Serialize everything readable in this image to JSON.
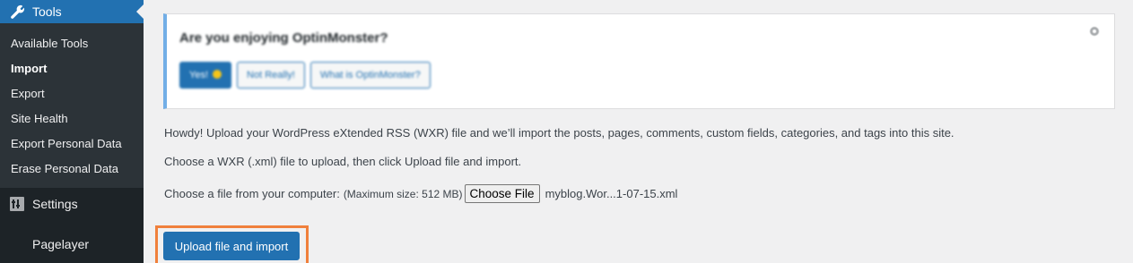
{
  "sidebar": {
    "tools_label": "Tools",
    "submenu": [
      {
        "label": "Available Tools"
      },
      {
        "label": "Import"
      },
      {
        "label": "Export"
      },
      {
        "label": "Site Health"
      },
      {
        "label": "Export Personal Data"
      },
      {
        "label": "Erase Personal Data"
      }
    ],
    "settings_label": "Settings",
    "pagelayer_label": "Pagelayer"
  },
  "notice": {
    "title": "Are you enjoying OptinMonster?",
    "yes_label": "Yes!",
    "not_really_label": "Not Really!",
    "what_is_label": "What is OptinMonster?"
  },
  "main": {
    "intro": "Howdy! Upload your WordPress eXtended RSS (WXR) file and we’ll import the posts, pages, comments, custom fields, categories, and tags into this site.",
    "instruction": "Choose a WXR (.xml) file to upload, then click Upload file and import.",
    "choose_label": "Choose a file from your computer:",
    "max_size": "(Maximum size: 512 MB)",
    "choose_button": "Choose File",
    "file_name": "myblog.Wor...1-07-15.xml",
    "upload_button": "Upload file and import"
  },
  "colors": {
    "admin_blue": "#2271b1",
    "sidebar_bg": "#1d2327",
    "highlight_orange": "#f0803c"
  }
}
